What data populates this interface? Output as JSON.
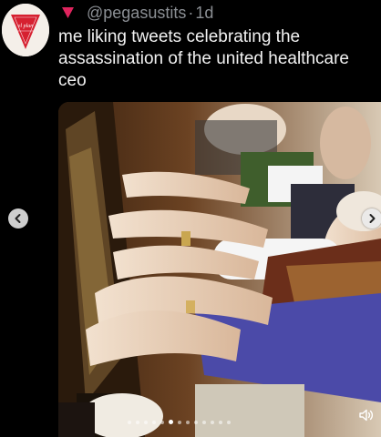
{
  "post": {
    "handle": "@pegasustits",
    "separator": "·",
    "age": "1d",
    "text": "me liking tweets celebrating the\nassassination of the united healthcare\nceo"
  },
  "avatar": {
    "logo_text": "el plan"
  },
  "media": {
    "type": "video",
    "slide_count": 13,
    "active_slide": 5
  },
  "icons": {
    "header": "red-triangle-icon",
    "prev": "chevron-left-icon",
    "next": "chevron-right-icon",
    "sound": "speaker-icon"
  },
  "colors": {
    "background": "#000000",
    "text": "#f2f2f2",
    "muted": "#8b8f94",
    "triangle": "#e0245e"
  }
}
